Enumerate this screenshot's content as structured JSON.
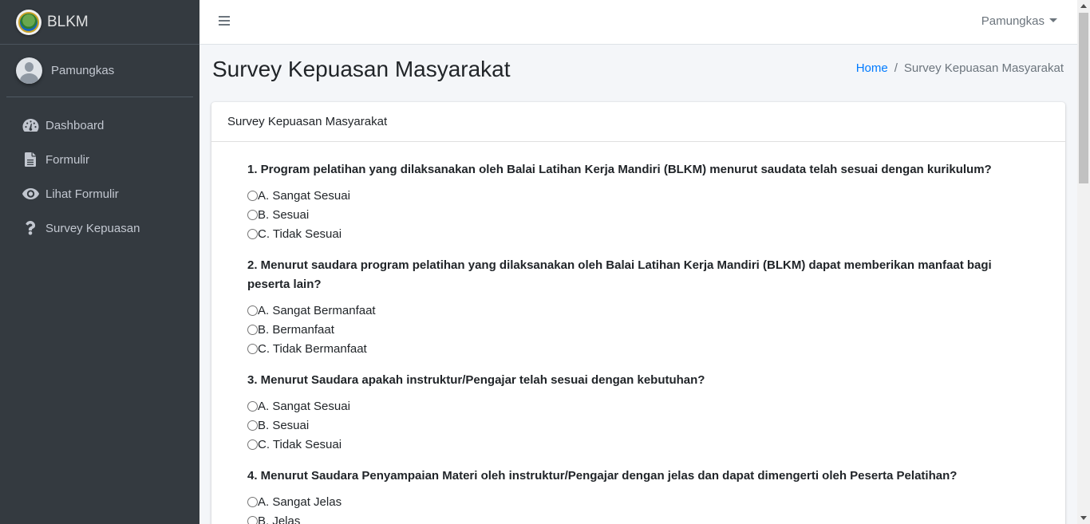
{
  "brand": {
    "title": "BLKM"
  },
  "user": {
    "name": "Pamungkas"
  },
  "sidebar": {
    "items": [
      {
        "label": "Dashboard",
        "icon": "tachometer-icon"
      },
      {
        "label": "Formulir",
        "icon": "file-icon"
      },
      {
        "label": "Lihat Formulir",
        "icon": "eye-icon"
      },
      {
        "label": "Survey Kepuasan",
        "icon": "question-icon"
      }
    ]
  },
  "navbar": {
    "user_label": "Pamungkas"
  },
  "page": {
    "title": "Survey Kepuasan Masyarakat",
    "breadcrumb": {
      "home": "Home",
      "separator": "/",
      "current": "Survey Kepuasan Masyarakat"
    }
  },
  "card": {
    "title": "Survey Kepuasan Masyarakat"
  },
  "questions": [
    {
      "text": "1. Program pelatihan yang dilaksanakan oleh Balai Latihan Kerja Mandiri (BLKM) menurut saudata telah sesuai dengan kurikulum?",
      "options": [
        "A. Sangat Sesuai",
        "B. Sesuai",
        "C. Tidak Sesuai"
      ]
    },
    {
      "text": "2. Menurut saudara program pelatihan yang dilaksanakan oleh Balai Latihan Kerja Mandiri (BLKM) dapat memberikan manfaat bagi peserta lain?",
      "options": [
        "A. Sangat Bermanfaat",
        "B. Bermanfaat",
        "C. Tidak Bermanfaat"
      ]
    },
    {
      "text": "3. Menurut Saudara apakah instruktur/Pengajar telah sesuai dengan kebutuhan?",
      "options": [
        "A. Sangat Sesuai",
        "B. Sesuai",
        "C. Tidak Sesuai"
      ]
    },
    {
      "text": "4. Menurut Saudara Penyampaian Materi oleh instruktur/Pengajar dengan jelas dan dapat dimengerti oleh Peserta Pelatihan?",
      "options": [
        "A. Sangat Jelas",
        "B. Jelas"
      ]
    }
  ],
  "colors": {
    "sidebar_bg": "#343a40",
    "link": "#007bff",
    "body_bg": "#f4f6f9"
  }
}
